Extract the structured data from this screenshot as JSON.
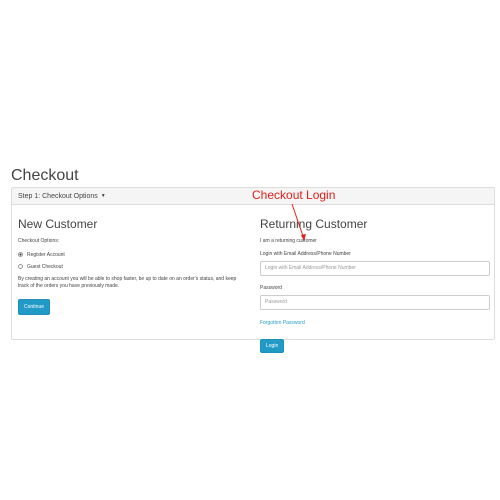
{
  "page": {
    "title": "Checkout"
  },
  "step": {
    "label": "Step 1: Checkout Options"
  },
  "new_customer": {
    "title": "New Customer",
    "options_label": "Checkout Options:",
    "register_label": "Register Account",
    "guest_label": "Guest Checkout",
    "description": "By creating an account you will be able to shop faster, be up to date on an order's status, and keep track of the orders you have previously made.",
    "continue_label": "Continue"
  },
  "returning_customer": {
    "title": "Returning Customer",
    "subtitle": "I am a returning customer",
    "email_label": "Login with Email Address/Phone Number",
    "email_placeholder": "Login with Email Address/Phone Number",
    "password_label": "Password",
    "password_placeholder": "Password",
    "forgotten_label": "Forgotten Password",
    "login_label": "Login"
  },
  "annotation": {
    "text": "Checkout Login",
    "color": "#e0201b"
  },
  "colors": {
    "accent": "#229ac8",
    "link": "#23a1d1"
  }
}
